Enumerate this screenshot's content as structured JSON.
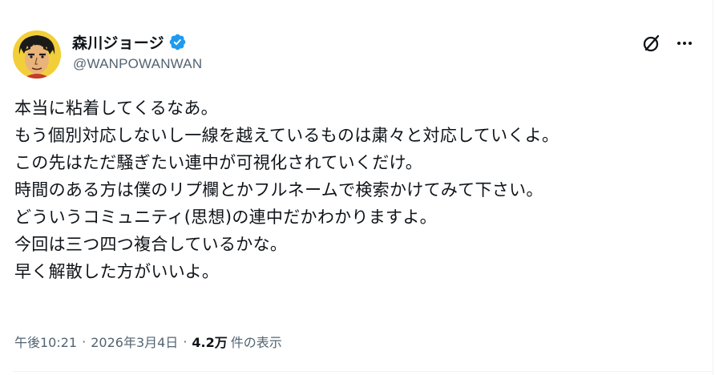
{
  "author": {
    "name": "森川ジョージ",
    "handle": "@WANPOWANWAN",
    "verified": true,
    "badge_color": "#1d9bf0"
  },
  "actions": {
    "grok_icon": "grok-icon",
    "more_icon": "more-icon"
  },
  "tweet": {
    "lines": [
      "本当に粘着してくるなあ。",
      "もう個別対応しないし一線を越えているものは粛々と対応していくよ。",
      "この先はただ騒ぎたい連中が可視化されていくだけ。",
      "時間のある方は僕のリプ欄とかフルネームで検索かけてみて下さい。",
      "どういうコミュニティ(思想)の連中だかわかりますよ。",
      "今回は三つ四つ複合しているかな。",
      "早く解散した方がいいよ。"
    ]
  },
  "meta": {
    "time": "午後10:21",
    "separator": "·",
    "date": "2026年3月4日",
    "views_count": "4.2万",
    "views_label": "件の表示"
  },
  "colors": {
    "text": "#0f1419",
    "secondary": "#536471",
    "border": "#eff3f4"
  }
}
